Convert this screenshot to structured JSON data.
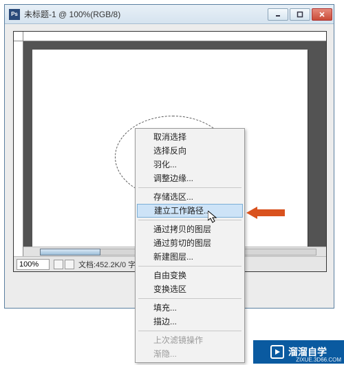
{
  "window": {
    "title": "未标题-1 @ 100%(RGB/8)"
  },
  "status": {
    "zoom": "100%",
    "doc_info": "文档:452.2K/0 字节"
  },
  "context_menu": {
    "items": [
      {
        "label": "取消选择",
        "disabled": false
      },
      {
        "label": "选择反向",
        "disabled": false
      },
      {
        "label": "羽化...",
        "disabled": false
      },
      {
        "label": "调整边缘...",
        "disabled": false
      }
    ],
    "group2": [
      {
        "label": "存储选区...",
        "disabled": false
      },
      {
        "label": "建立工作路径...",
        "disabled": false,
        "highlight": true
      }
    ],
    "group3": [
      {
        "label": "通过拷贝的图层",
        "disabled": false
      },
      {
        "label": "通过剪切的图层",
        "disabled": false
      },
      {
        "label": "新建图层...",
        "disabled": false
      }
    ],
    "group4": [
      {
        "label": "自由变换",
        "disabled": false
      },
      {
        "label": "变换选区",
        "disabled": false
      }
    ],
    "group5": [
      {
        "label": "填充...",
        "disabled": false
      },
      {
        "label": "描边...",
        "disabled": false
      }
    ],
    "group6": [
      {
        "label": "上次滤镜操作",
        "disabled": true
      },
      {
        "label": "渐隐...",
        "disabled": true
      }
    ]
  },
  "watermark": {
    "brand": "溜溜自学",
    "url": "ZIXUE.3D66.COM"
  }
}
